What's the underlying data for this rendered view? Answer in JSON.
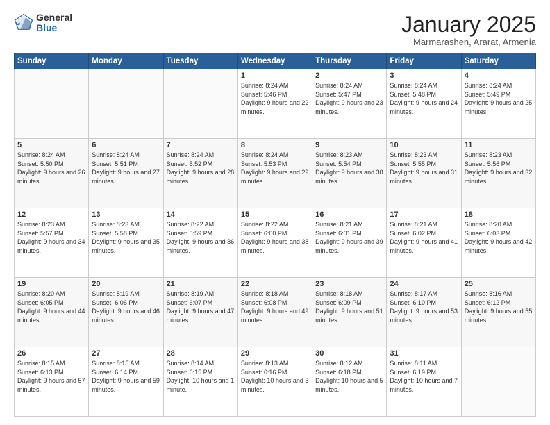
{
  "logo": {
    "general": "General",
    "blue": "Blue"
  },
  "header": {
    "month": "January 2025",
    "location": "Marmarashen, Ararat, Armenia"
  },
  "weekdays": [
    "Sunday",
    "Monday",
    "Tuesday",
    "Wednesday",
    "Thursday",
    "Friday",
    "Saturday"
  ],
  "weeks": [
    [
      {
        "day": "",
        "sunrise": "",
        "sunset": "",
        "daylight": ""
      },
      {
        "day": "",
        "sunrise": "",
        "sunset": "",
        "daylight": ""
      },
      {
        "day": "",
        "sunrise": "",
        "sunset": "",
        "daylight": ""
      },
      {
        "day": "1",
        "sunrise": "Sunrise: 8:24 AM",
        "sunset": "Sunset: 5:46 PM",
        "daylight": "Daylight: 9 hours and 22 minutes."
      },
      {
        "day": "2",
        "sunrise": "Sunrise: 8:24 AM",
        "sunset": "Sunset: 5:47 PM",
        "daylight": "Daylight: 9 hours and 23 minutes."
      },
      {
        "day": "3",
        "sunrise": "Sunrise: 8:24 AM",
        "sunset": "Sunset: 5:48 PM",
        "daylight": "Daylight: 9 hours and 24 minutes."
      },
      {
        "day": "4",
        "sunrise": "Sunrise: 8:24 AM",
        "sunset": "Sunset: 5:49 PM",
        "daylight": "Daylight: 9 hours and 25 minutes."
      }
    ],
    [
      {
        "day": "5",
        "sunrise": "Sunrise: 8:24 AM",
        "sunset": "Sunset: 5:50 PM",
        "daylight": "Daylight: 9 hours and 26 minutes."
      },
      {
        "day": "6",
        "sunrise": "Sunrise: 8:24 AM",
        "sunset": "Sunset: 5:51 PM",
        "daylight": "Daylight: 9 hours and 27 minutes."
      },
      {
        "day": "7",
        "sunrise": "Sunrise: 8:24 AM",
        "sunset": "Sunset: 5:52 PM",
        "daylight": "Daylight: 9 hours and 28 minutes."
      },
      {
        "day": "8",
        "sunrise": "Sunrise: 8:24 AM",
        "sunset": "Sunset: 5:53 PM",
        "daylight": "Daylight: 9 hours and 29 minutes."
      },
      {
        "day": "9",
        "sunrise": "Sunrise: 8:23 AM",
        "sunset": "Sunset: 5:54 PM",
        "daylight": "Daylight: 9 hours and 30 minutes."
      },
      {
        "day": "10",
        "sunrise": "Sunrise: 8:23 AM",
        "sunset": "Sunset: 5:55 PM",
        "daylight": "Daylight: 9 hours and 31 minutes."
      },
      {
        "day": "11",
        "sunrise": "Sunrise: 8:23 AM",
        "sunset": "Sunset: 5:56 PM",
        "daylight": "Daylight: 9 hours and 32 minutes."
      }
    ],
    [
      {
        "day": "12",
        "sunrise": "Sunrise: 8:23 AM",
        "sunset": "Sunset: 5:57 PM",
        "daylight": "Daylight: 9 hours and 34 minutes."
      },
      {
        "day": "13",
        "sunrise": "Sunrise: 8:23 AM",
        "sunset": "Sunset: 5:58 PM",
        "daylight": "Daylight: 9 hours and 35 minutes."
      },
      {
        "day": "14",
        "sunrise": "Sunrise: 8:22 AM",
        "sunset": "Sunset: 5:59 PM",
        "daylight": "Daylight: 9 hours and 36 minutes."
      },
      {
        "day": "15",
        "sunrise": "Sunrise: 8:22 AM",
        "sunset": "Sunset: 6:00 PM",
        "daylight": "Daylight: 9 hours and 38 minutes."
      },
      {
        "day": "16",
        "sunrise": "Sunrise: 8:21 AM",
        "sunset": "Sunset: 6:01 PM",
        "daylight": "Daylight: 9 hours and 39 minutes."
      },
      {
        "day": "17",
        "sunrise": "Sunrise: 8:21 AM",
        "sunset": "Sunset: 6:02 PM",
        "daylight": "Daylight: 9 hours and 41 minutes."
      },
      {
        "day": "18",
        "sunrise": "Sunrise: 8:20 AM",
        "sunset": "Sunset: 6:03 PM",
        "daylight": "Daylight: 9 hours and 42 minutes."
      }
    ],
    [
      {
        "day": "19",
        "sunrise": "Sunrise: 8:20 AM",
        "sunset": "Sunset: 6:05 PM",
        "daylight": "Daylight: 9 hours and 44 minutes."
      },
      {
        "day": "20",
        "sunrise": "Sunrise: 8:19 AM",
        "sunset": "Sunset: 6:06 PM",
        "daylight": "Daylight: 9 hours and 46 minutes."
      },
      {
        "day": "21",
        "sunrise": "Sunrise: 8:19 AM",
        "sunset": "Sunset: 6:07 PM",
        "daylight": "Daylight: 9 hours and 47 minutes."
      },
      {
        "day": "22",
        "sunrise": "Sunrise: 8:18 AM",
        "sunset": "Sunset: 6:08 PM",
        "daylight": "Daylight: 9 hours and 49 minutes."
      },
      {
        "day": "23",
        "sunrise": "Sunrise: 8:18 AM",
        "sunset": "Sunset: 6:09 PM",
        "daylight": "Daylight: 9 hours and 51 minutes."
      },
      {
        "day": "24",
        "sunrise": "Sunrise: 8:17 AM",
        "sunset": "Sunset: 6:10 PM",
        "daylight": "Daylight: 9 hours and 53 minutes."
      },
      {
        "day": "25",
        "sunrise": "Sunrise: 8:16 AM",
        "sunset": "Sunset: 6:12 PM",
        "daylight": "Daylight: 9 hours and 55 minutes."
      }
    ],
    [
      {
        "day": "26",
        "sunrise": "Sunrise: 8:15 AM",
        "sunset": "Sunset: 6:13 PM",
        "daylight": "Daylight: 9 hours and 57 minutes."
      },
      {
        "day": "27",
        "sunrise": "Sunrise: 8:15 AM",
        "sunset": "Sunset: 6:14 PM",
        "daylight": "Daylight: 9 hours and 59 minutes."
      },
      {
        "day": "28",
        "sunrise": "Sunrise: 8:14 AM",
        "sunset": "Sunset: 6:15 PM",
        "daylight": "Daylight: 10 hours and 1 minute."
      },
      {
        "day": "29",
        "sunrise": "Sunrise: 8:13 AM",
        "sunset": "Sunset: 6:16 PM",
        "daylight": "Daylight: 10 hours and 3 minutes."
      },
      {
        "day": "30",
        "sunrise": "Sunrise: 8:12 AM",
        "sunset": "Sunset: 6:18 PM",
        "daylight": "Daylight: 10 hours and 5 minutes."
      },
      {
        "day": "31",
        "sunrise": "Sunrise: 8:11 AM",
        "sunset": "Sunset: 6:19 PM",
        "daylight": "Daylight: 10 hours and 7 minutes."
      },
      {
        "day": "",
        "sunrise": "",
        "sunset": "",
        "daylight": ""
      }
    ]
  ]
}
